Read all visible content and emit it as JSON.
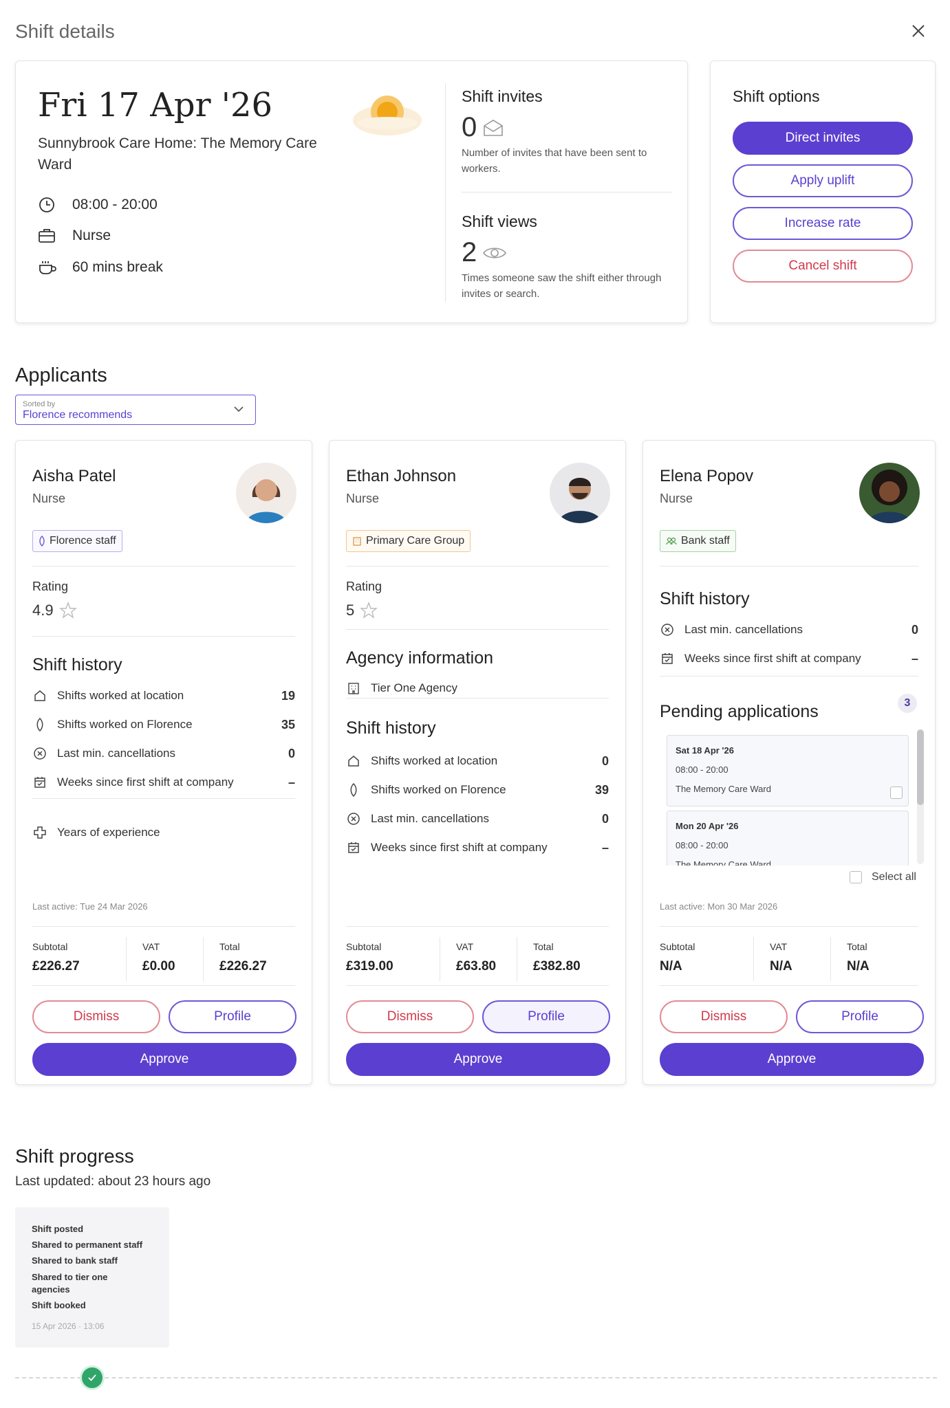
{
  "header": {
    "title": "Shift details"
  },
  "shift": {
    "date": "Fri 17 Apr '26",
    "location": "Sunnybrook Care Home: The Memory Care Ward",
    "time": "08:00 - 20:00",
    "role": "Nurse",
    "break": "60 mins break"
  },
  "invites": {
    "title": "Shift invites",
    "count": "0",
    "desc": "Number of invites that have been sent to workers."
  },
  "views": {
    "title": "Shift views",
    "count": "2",
    "desc": "Times someone saw the shift either through invites or search."
  },
  "options": {
    "title": "Shift options",
    "direct_invites": "Direct invites",
    "apply_uplift": "Apply uplift",
    "increase_rate": "Increase rate",
    "cancel_shift": "Cancel shift"
  },
  "applicants": {
    "title": "Applicants",
    "sort_label": "Sorted by",
    "sort_value": "Florence recommends",
    "cards": [
      {
        "name": "Aisha Patel",
        "role": "Nurse",
        "tag": "Florence staff",
        "rating_label": "Rating",
        "rating": "4.9",
        "history_title": "Shift history",
        "history": [
          {
            "label": "Shifts worked at location",
            "value": "19"
          },
          {
            "label": "Shifts worked on Florence",
            "value": "35"
          },
          {
            "label": "Last min. cancellations",
            "value": "0"
          },
          {
            "label": "Weeks since first shift at company",
            "value": "–"
          }
        ],
        "experience": "Years of experience",
        "last_active": "Last active: Tue 24 Mar 2026",
        "subtotal_label": "Subtotal",
        "subtotal": "£226.27",
        "vat_label": "VAT",
        "vat": "£0.00",
        "total_label": "Total",
        "total": "£226.27",
        "dismiss": "Dismiss",
        "profile": "Profile",
        "approve": "Approve"
      },
      {
        "name": "Ethan Johnson",
        "role": "Nurse",
        "tag": "Primary Care Group",
        "rating_label": "Rating",
        "rating": "5",
        "agency_title": "Agency information",
        "agency": "Tier One Agency",
        "history_title": "Shift history",
        "history": [
          {
            "label": "Shifts worked at location",
            "value": "0"
          },
          {
            "label": "Shifts worked on Florence",
            "value": "39"
          },
          {
            "label": "Last min. cancellations",
            "value": "0"
          },
          {
            "label": "Weeks since first shift at company",
            "value": "–"
          }
        ],
        "subtotal_label": "Subtotal",
        "subtotal": "£319.00",
        "vat_label": "VAT",
        "vat": "£63.80",
        "total_label": "Total",
        "total": "£382.80",
        "dismiss": "Dismiss",
        "profile": "Profile",
        "approve": "Approve"
      },
      {
        "name": "Elena Popov",
        "role": "Nurse",
        "tag": "Bank staff",
        "history_title": "Shift history",
        "history": [
          {
            "label": "Last min. cancellations",
            "value": "0"
          },
          {
            "label": "Weeks since first shift at company",
            "value": "–"
          }
        ],
        "pending_title": "Pending applications",
        "pending_count": "3",
        "pending": [
          {
            "date": "Sat 18 Apr '26",
            "time": "08:00 - 20:00",
            "ward": "The Memory Care Ward"
          },
          {
            "date": "Mon 20 Apr '26",
            "time": "08:00 - 20:00",
            "ward": "The Memory Care Ward"
          }
        ],
        "select_all": "Select all",
        "last_active": "Last active: Mon 30 Mar 2026",
        "subtotal_label": "Subtotal",
        "subtotal": "N/A",
        "vat_label": "VAT",
        "vat": "N/A",
        "total_label": "Total",
        "total": "N/A",
        "dismiss": "Dismiss",
        "profile": "Profile",
        "approve": "Approve"
      }
    ]
  },
  "progress": {
    "title": "Shift progress",
    "updated": "Last updated: about 23 hours ago",
    "steps": [
      "Shift posted",
      "Shared to permanent staff",
      "Shared to bank staff",
      "Shared to tier one agencies",
      "Shift booked"
    ],
    "timestamp": "15 Apr 2026 · 13:06"
  },
  "colors": {
    "accent": "#5b3fd0",
    "danger": "#d1394b",
    "success": "#2fa56a"
  }
}
